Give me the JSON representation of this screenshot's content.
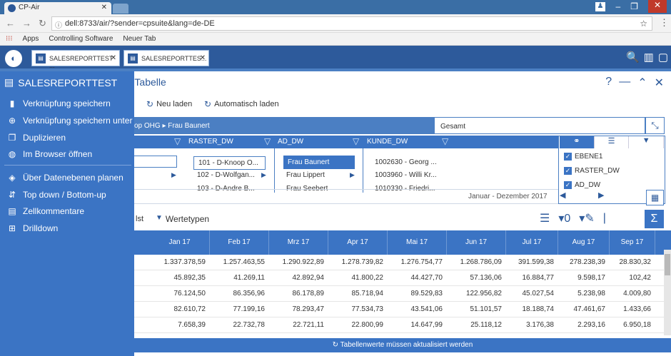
{
  "browser": {
    "tab_title": "CP-Air",
    "url": "dell:8733/air/?sender=cpsuite&lang=de-DE",
    "bookmarks": [
      "Apps",
      "Controlling Software",
      "Neuer Tab"
    ]
  },
  "app": {
    "tabs": [
      "SALESREPORTTEST ...",
      "SALESREPORTTES..."
    ]
  },
  "sidebar": {
    "title": "SALESREPORTTEST",
    "items": [
      {
        "label": "Verknüpfung speichern",
        "icon": "bookmark-icon"
      },
      {
        "label": "Verknüpfung speichern unter",
        "icon": "bookmark-plus-icon"
      },
      {
        "label": "Duplizieren",
        "icon": "duplicate-icon"
      },
      {
        "label": "Im Browser öffnen",
        "icon": "globe-icon"
      },
      {
        "label": "Über Datenebenen planen",
        "icon": "layers-icon"
      },
      {
        "label": "Top down / Bottom-up",
        "icon": "topdown-icon"
      },
      {
        "label": "Zellkommentare",
        "icon": "comment-icon"
      },
      {
        "label": "Drilldown",
        "icon": "drilldown-icon"
      }
    ]
  },
  "main": {
    "title": "– Tabelle",
    "reload": "Neu laden",
    "auto_reload": "Automatisch laden",
    "breadcrumb_prefix": "op OHG",
    "breadcrumb_current": "Frau Baunert",
    "total": "Gesamt",
    "level_headers": [
      "RASTER_DW",
      "AD_DW",
      "KUNDE_DW"
    ],
    "raster_nodes": [
      "101 - D-Knoop O...",
      "102 - D-Wolfgan...",
      "103 - D-Andre B..."
    ],
    "ad_nodes": [
      "Frau Baunert",
      "Frau Lippert",
      "Frau Seebert"
    ],
    "kunde_nodes": [
      "1002630 - Georg ...",
      "1003960 - Willi Kr...",
      "1010330 - Friedri..."
    ],
    "levels": [
      "EBENE1",
      "RASTER_DW",
      "AD_DW"
    ],
    "date_range": "Januar - Dezember 2017",
    "list_label": "lst",
    "werttypen": "Wertetypen"
  },
  "table": {
    "columns": [
      "Jan 17",
      "Feb 17",
      "Mrz 17",
      "Apr 17",
      "Mai 17",
      "Jun 17",
      "Jul 17",
      "Aug 17",
      "Sep 17"
    ],
    "rows": [
      [
        "1.337.378,59",
        "1.257.463,55",
        "1.290.922,89",
        "1.278.739,82",
        "1.276.754,77",
        "1.268.786,09",
        "391.599,38",
        "278.238,39",
        "28.830,32"
      ],
      [
        "45.892,35",
        "41.269,11",
        "42.892,94",
        "41.800,22",
        "44.427,70",
        "57.136,06",
        "16.884,77",
        "9.598,17",
        "102,42"
      ],
      [
        "76.124,50",
        "86.356,96",
        "86.178,89",
        "85.718,94",
        "89.529,83",
        "122.956,82",
        "45.027,54",
        "5.238,98",
        "4.009,80"
      ],
      [
        "82.610,72",
        "77.199,16",
        "78.293,47",
        "77.534,73",
        "43.541,06",
        "51.101,57",
        "18.188,74",
        "47.461,67",
        "1.433,66"
      ],
      [
        "7.658,39",
        "22.732,78",
        "22.721,11",
        "22.800,99",
        "14.647,99",
        "25.118,12",
        "3.176,38",
        "2.293,16",
        "6.950,18"
      ]
    ],
    "status": "Tabellenwerte müssen aktualisiert werden"
  }
}
